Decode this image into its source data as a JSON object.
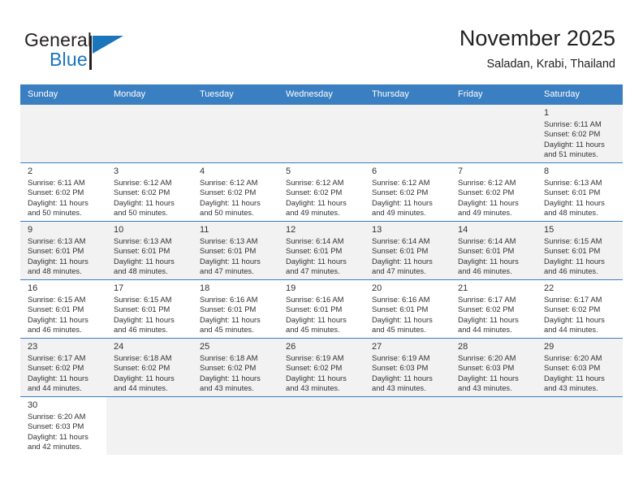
{
  "brand": {
    "name_part1": "General",
    "name_part2": "Blue",
    "accent_color": "#1b75bb"
  },
  "header": {
    "title": "November 2025",
    "location": "Saladan, Krabi, Thailand"
  },
  "calendar": {
    "header_bg": "#3a7fc1",
    "weekday_labels": [
      "Sunday",
      "Monday",
      "Tuesday",
      "Wednesday",
      "Thursday",
      "Friday",
      "Saturday"
    ],
    "labels": {
      "sunrise": "Sunrise:",
      "sunset": "Sunset:",
      "daylight": "Daylight:"
    },
    "weeks": [
      [
        {
          "day": "",
          "empty": true
        },
        {
          "day": "",
          "empty": true
        },
        {
          "day": "",
          "empty": true
        },
        {
          "day": "",
          "empty": true
        },
        {
          "day": "",
          "empty": true
        },
        {
          "day": "",
          "empty": true
        },
        {
          "day": "1",
          "sunrise": "Sunrise: 6:11 AM",
          "sunset": "Sunset: 6:02 PM",
          "daylight1": "Daylight: 11 hours",
          "daylight2": "and 51 minutes."
        }
      ],
      [
        {
          "day": "2",
          "sunrise": "Sunrise: 6:11 AM",
          "sunset": "Sunset: 6:02 PM",
          "daylight1": "Daylight: 11 hours",
          "daylight2": "and 50 minutes."
        },
        {
          "day": "3",
          "sunrise": "Sunrise: 6:12 AM",
          "sunset": "Sunset: 6:02 PM",
          "daylight1": "Daylight: 11 hours",
          "daylight2": "and 50 minutes."
        },
        {
          "day": "4",
          "sunrise": "Sunrise: 6:12 AM",
          "sunset": "Sunset: 6:02 PM",
          "daylight1": "Daylight: 11 hours",
          "daylight2": "and 50 minutes."
        },
        {
          "day": "5",
          "sunrise": "Sunrise: 6:12 AM",
          "sunset": "Sunset: 6:02 PM",
          "daylight1": "Daylight: 11 hours",
          "daylight2": "and 49 minutes."
        },
        {
          "day": "6",
          "sunrise": "Sunrise: 6:12 AM",
          "sunset": "Sunset: 6:02 PM",
          "daylight1": "Daylight: 11 hours",
          "daylight2": "and 49 minutes."
        },
        {
          "day": "7",
          "sunrise": "Sunrise: 6:12 AM",
          "sunset": "Sunset: 6:02 PM",
          "daylight1": "Daylight: 11 hours",
          "daylight2": "and 49 minutes."
        },
        {
          "day": "8",
          "sunrise": "Sunrise: 6:13 AM",
          "sunset": "Sunset: 6:01 PM",
          "daylight1": "Daylight: 11 hours",
          "daylight2": "and 48 minutes."
        }
      ],
      [
        {
          "day": "9",
          "sunrise": "Sunrise: 6:13 AM",
          "sunset": "Sunset: 6:01 PM",
          "daylight1": "Daylight: 11 hours",
          "daylight2": "and 48 minutes."
        },
        {
          "day": "10",
          "sunrise": "Sunrise: 6:13 AM",
          "sunset": "Sunset: 6:01 PM",
          "daylight1": "Daylight: 11 hours",
          "daylight2": "and 48 minutes."
        },
        {
          "day": "11",
          "sunrise": "Sunrise: 6:13 AM",
          "sunset": "Sunset: 6:01 PM",
          "daylight1": "Daylight: 11 hours",
          "daylight2": "and 47 minutes."
        },
        {
          "day": "12",
          "sunrise": "Sunrise: 6:14 AM",
          "sunset": "Sunset: 6:01 PM",
          "daylight1": "Daylight: 11 hours",
          "daylight2": "and 47 minutes."
        },
        {
          "day": "13",
          "sunrise": "Sunrise: 6:14 AM",
          "sunset": "Sunset: 6:01 PM",
          "daylight1": "Daylight: 11 hours",
          "daylight2": "and 47 minutes."
        },
        {
          "day": "14",
          "sunrise": "Sunrise: 6:14 AM",
          "sunset": "Sunset: 6:01 PM",
          "daylight1": "Daylight: 11 hours",
          "daylight2": "and 46 minutes."
        },
        {
          "day": "15",
          "sunrise": "Sunrise: 6:15 AM",
          "sunset": "Sunset: 6:01 PM",
          "daylight1": "Daylight: 11 hours",
          "daylight2": "and 46 minutes."
        }
      ],
      [
        {
          "day": "16",
          "sunrise": "Sunrise: 6:15 AM",
          "sunset": "Sunset: 6:01 PM",
          "daylight1": "Daylight: 11 hours",
          "daylight2": "and 46 minutes."
        },
        {
          "day": "17",
          "sunrise": "Sunrise: 6:15 AM",
          "sunset": "Sunset: 6:01 PM",
          "daylight1": "Daylight: 11 hours",
          "daylight2": "and 46 minutes."
        },
        {
          "day": "18",
          "sunrise": "Sunrise: 6:16 AM",
          "sunset": "Sunset: 6:01 PM",
          "daylight1": "Daylight: 11 hours",
          "daylight2": "and 45 minutes."
        },
        {
          "day": "19",
          "sunrise": "Sunrise: 6:16 AM",
          "sunset": "Sunset: 6:01 PM",
          "daylight1": "Daylight: 11 hours",
          "daylight2": "and 45 minutes."
        },
        {
          "day": "20",
          "sunrise": "Sunrise: 6:16 AM",
          "sunset": "Sunset: 6:01 PM",
          "daylight1": "Daylight: 11 hours",
          "daylight2": "and 45 minutes."
        },
        {
          "day": "21",
          "sunrise": "Sunrise: 6:17 AM",
          "sunset": "Sunset: 6:02 PM",
          "daylight1": "Daylight: 11 hours",
          "daylight2": "and 44 minutes."
        },
        {
          "day": "22",
          "sunrise": "Sunrise: 6:17 AM",
          "sunset": "Sunset: 6:02 PM",
          "daylight1": "Daylight: 11 hours",
          "daylight2": "and 44 minutes."
        }
      ],
      [
        {
          "day": "23",
          "sunrise": "Sunrise: 6:17 AM",
          "sunset": "Sunset: 6:02 PM",
          "daylight1": "Daylight: 11 hours",
          "daylight2": "and 44 minutes."
        },
        {
          "day": "24",
          "sunrise": "Sunrise: 6:18 AM",
          "sunset": "Sunset: 6:02 PM",
          "daylight1": "Daylight: 11 hours",
          "daylight2": "and 44 minutes."
        },
        {
          "day": "25",
          "sunrise": "Sunrise: 6:18 AM",
          "sunset": "Sunset: 6:02 PM",
          "daylight1": "Daylight: 11 hours",
          "daylight2": "and 43 minutes."
        },
        {
          "day": "26",
          "sunrise": "Sunrise: 6:19 AM",
          "sunset": "Sunset: 6:02 PM",
          "daylight1": "Daylight: 11 hours",
          "daylight2": "and 43 minutes."
        },
        {
          "day": "27",
          "sunrise": "Sunrise: 6:19 AM",
          "sunset": "Sunset: 6:03 PM",
          "daylight1": "Daylight: 11 hours",
          "daylight2": "and 43 minutes."
        },
        {
          "day": "28",
          "sunrise": "Sunrise: 6:20 AM",
          "sunset": "Sunset: 6:03 PM",
          "daylight1": "Daylight: 11 hours",
          "daylight2": "and 43 minutes."
        },
        {
          "day": "29",
          "sunrise": "Sunrise: 6:20 AM",
          "sunset": "Sunset: 6:03 PM",
          "daylight1": "Daylight: 11 hours",
          "daylight2": "and 43 minutes."
        }
      ],
      [
        {
          "day": "30",
          "sunrise": "Sunrise: 6:20 AM",
          "sunset": "Sunset: 6:03 PM",
          "daylight1": "Daylight: 11 hours",
          "daylight2": "and 42 minutes."
        },
        {
          "day": "",
          "empty": true
        },
        {
          "day": "",
          "empty": true
        },
        {
          "day": "",
          "empty": true
        },
        {
          "day": "",
          "empty": true
        },
        {
          "day": "",
          "empty": true
        },
        {
          "day": "",
          "empty": true
        }
      ]
    ]
  }
}
